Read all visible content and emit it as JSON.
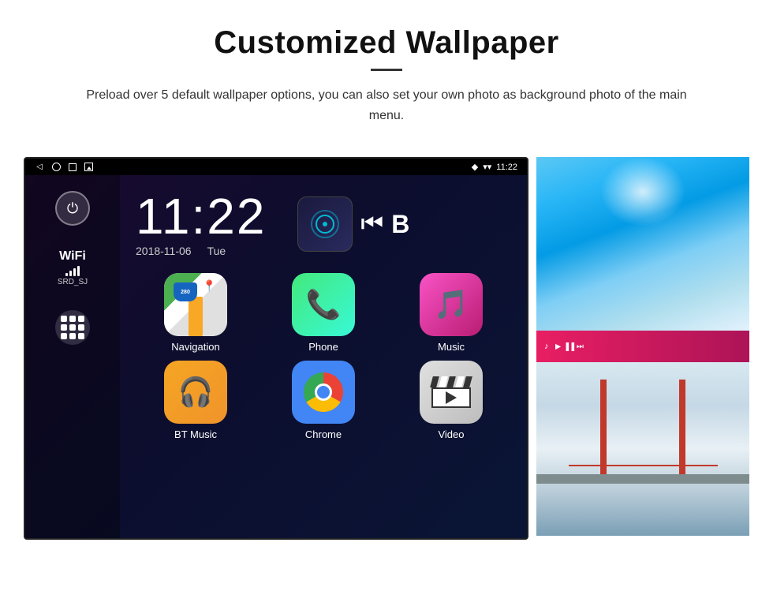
{
  "header": {
    "title": "Customized Wallpaper",
    "subtitle": "Preload over 5 default wallpaper options, you can also set your own photo as background photo of the main menu."
  },
  "screen": {
    "status_bar": {
      "time": "11:22",
      "wifi_icon": "wifi",
      "signal_icon": "signal",
      "location_icon": "location"
    },
    "clock": {
      "time": "11:22",
      "date": "2018-11-06",
      "day": "Tue"
    },
    "wifi": {
      "label": "WiFi",
      "ssid": "SRD_SJ"
    },
    "apps": [
      {
        "id": "navigation",
        "label": "Navigation",
        "icon": "nav"
      },
      {
        "id": "phone",
        "label": "Phone",
        "icon": "phone"
      },
      {
        "id": "music",
        "label": "Music",
        "icon": "music"
      },
      {
        "id": "bt-music",
        "label": "BT Music",
        "icon": "bt"
      },
      {
        "id": "chrome",
        "label": "Chrome",
        "icon": "chrome"
      },
      {
        "id": "video",
        "label": "Video",
        "icon": "video"
      }
    ],
    "nav_shield_text": "280",
    "nav_label": "Navigation"
  },
  "wallpapers": [
    {
      "id": "ice",
      "style": "ice-blue"
    },
    {
      "id": "bridge",
      "style": "golden-gate"
    }
  ]
}
